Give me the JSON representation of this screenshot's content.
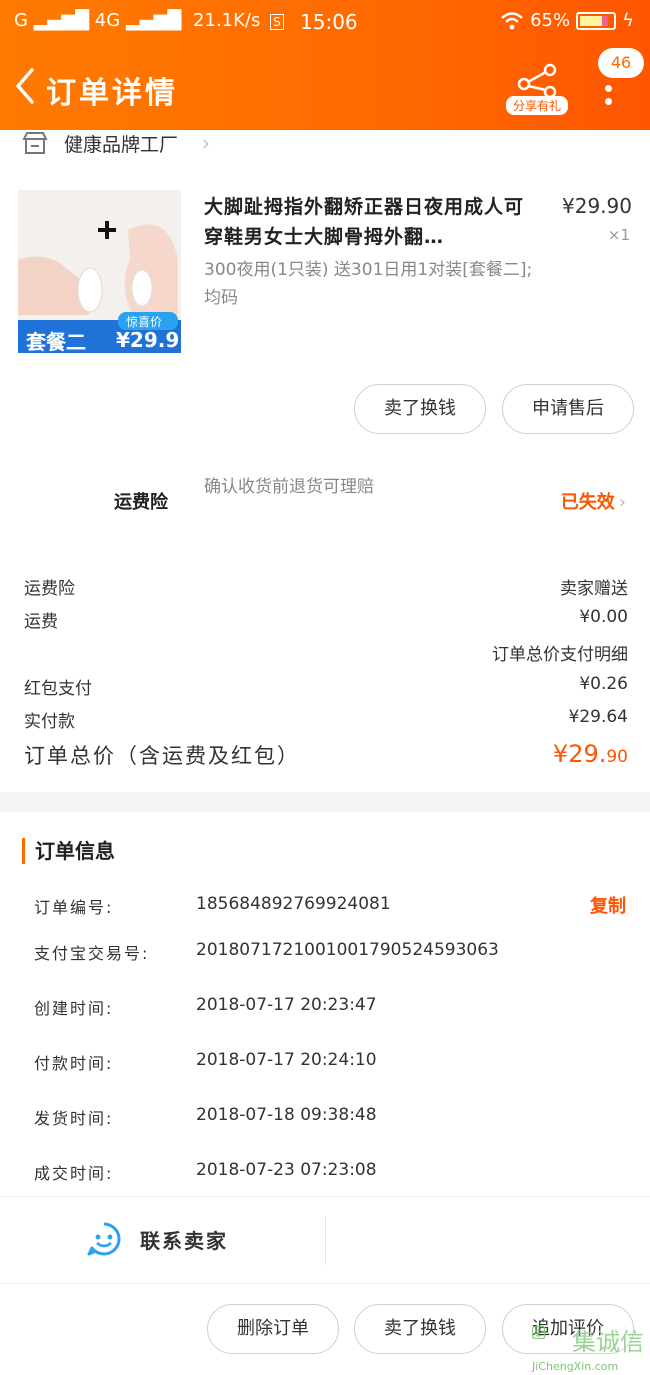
{
  "status_bar": {
    "carrier": "G",
    "network": "4G",
    "speed": "21.1K/s",
    "time": "15:06",
    "battery": "65%",
    "icons": [
      "signal-icon",
      "wifi-icon",
      "battery-icon",
      "charging-icon"
    ]
  },
  "nav": {
    "title": "订单详情",
    "share_label": "分享有礼",
    "badge_count": "46"
  },
  "shop": {
    "name": "健康品牌工厂"
  },
  "product": {
    "image_label_left": "套餐二",
    "image_label_tag": "惊喜价",
    "image_label_price": "¥29.9",
    "title": "大脚趾拇指外翻矫正器日夜用成人可穿鞋男女士大脚骨拇外翻…",
    "spec": "300夜用(1只装) 送301日用1对装[套餐二];均码",
    "price": "¥29.90",
    "qty": "×1"
  },
  "buttons": {
    "sell_swap": "卖了换钱",
    "after_sale": "申请售后",
    "delete_order": "删除订单",
    "add_review": "追加评价"
  },
  "insurance": {
    "label": "运费险",
    "desc": "确认收货前退货可理赔",
    "status": "已失效"
  },
  "summary": {
    "rows": [
      {
        "label": "运费险",
        "value": "卖家赠送"
      },
      {
        "label": "运费",
        "value": "¥0.00"
      },
      {
        "label": "",
        "value": "订单总价支付明细"
      },
      {
        "label": "红包支付",
        "value": "¥0.26"
      },
      {
        "label": "实付款",
        "value": "¥29.64"
      }
    ],
    "total_label": "订单总价（含运费及红包）",
    "total_value_main": "¥29.",
    "total_value_cents": "90"
  },
  "order_info": {
    "title": "订单信息",
    "copy_label": "复制",
    "rows": [
      {
        "label": "订单编号:",
        "value": "185684892769924081"
      },
      {
        "label": "支付宝交易号:",
        "value": "2018071721001001790524593063"
      },
      {
        "label": "创建时间:",
        "value": "2018-07-17 20:23:47"
      },
      {
        "label": "付款时间:",
        "value": "2018-07-17 20:24:10"
      },
      {
        "label": "发货时间:",
        "value": "2018-07-18 09:38:48"
      },
      {
        "label": "成交时间:",
        "value": "2018-07-23 07:23:08"
      }
    ]
  },
  "contact": {
    "label": "联系卖家"
  },
  "watermark": {
    "text": "集诚信",
    "sub": "JiChengXin.com"
  },
  "colors": {
    "brand_orange": "#ff6a00",
    "price_orange": "#ff5500"
  }
}
